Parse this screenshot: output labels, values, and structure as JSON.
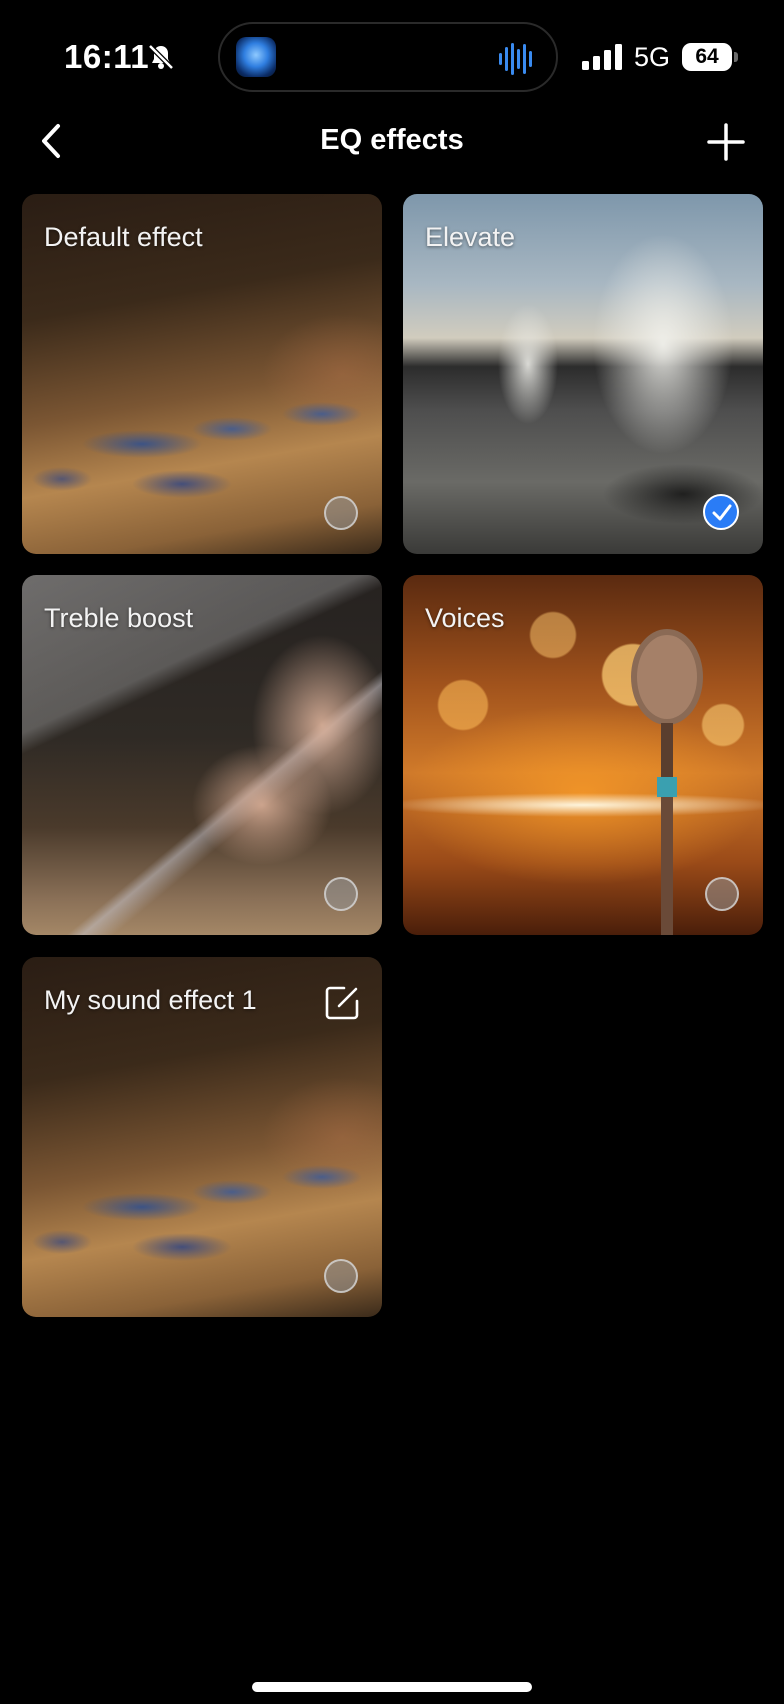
{
  "status_bar": {
    "time": "16:11",
    "network": "5G",
    "battery": "64"
  },
  "nav": {
    "title": "EQ effects"
  },
  "effects": [
    {
      "label": "Default effect",
      "selected": false,
      "editable": false
    },
    {
      "label": "Elevate",
      "selected": true,
      "editable": false
    },
    {
      "label": "Treble boost",
      "selected": false,
      "editable": false
    },
    {
      "label": "Voices",
      "selected": false,
      "editable": false
    },
    {
      "label": "My sound effect 1",
      "selected": false,
      "editable": true
    }
  ],
  "colors": {
    "background": "#000000",
    "accent": "#2a7cf6"
  }
}
